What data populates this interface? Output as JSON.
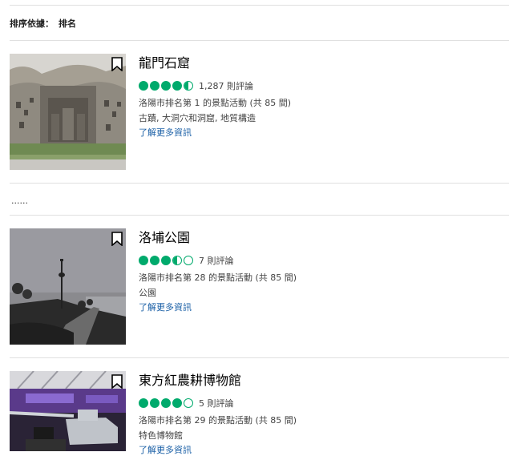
{
  "sort": {
    "label": "排序依據：",
    "value": "排名"
  },
  "ellipsis": "......",
  "rating_color": "#00aa6c",
  "link_color": "#1a5fa6",
  "items": [
    {
      "title": "龍門石窟",
      "rating": 4.5,
      "reviews": "1,287 則評論",
      "rank": "洛陽市排名第 1 的景點活動 (共 85 間)",
      "tags": "古蹟, 大洞穴和洞窟, 地質構造",
      "more": "了解更多資訊",
      "bookmark_icon": "bookmark-icon"
    },
    {
      "title": "洛埔公園",
      "rating": 3.5,
      "reviews": "7 則評論",
      "rank": "洛陽市排名第 28 的景點活動 (共 85 間)",
      "tags": "公園",
      "more": "了解更多資訊",
      "bookmark_icon": "bookmark-icon"
    },
    {
      "title": "東方紅農耕博物館",
      "rating": 4,
      "reviews": "5 則評論",
      "rank": "洛陽市排名第 29 的景點活動 (共 85 間)",
      "tags": "特色博物館",
      "more": "了解更多資訊",
      "bookmark_icon": "bookmark-icon"
    }
  ]
}
